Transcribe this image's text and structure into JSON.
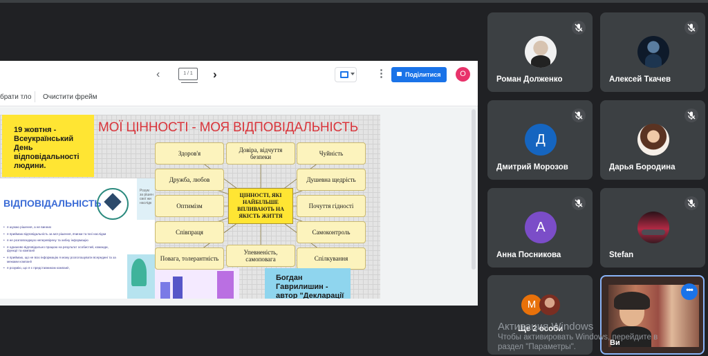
{
  "share": {
    "page_indicator": "1 / 1",
    "share_button": "Поділитися",
    "user_initial": "O",
    "toolbar2": {
      "item1": "брати тло",
      "item2": "Очистити фрейм"
    }
  },
  "slide": {
    "date_box": {
      "line1": "19 жовтня -",
      "line2": "Всеукраїнський",
      "line3": "День",
      "line4": "відповідальності",
      "line5": "людини."
    },
    "title": "МОЇ ЦІННОСТІ - МОЯ ВІДПОВІДАЛЬНІСТЬ",
    "resp_title": "ВІДПОВІДАЛЬНІСТЬ",
    "resp_side": {
      "l1": "Розум",
      "l2": "за рішен",
      "l3": "свої жи",
      "l4": "наслідк"
    },
    "resp_items": [
      "я шукаю рішення, а не винних",
      "я приймаю відповідальність за мої рішення, вчинки та їхні наслідки",
      "я не розповсюджую неперевірену та хибну інформацію",
      "я однаково відповідально працюю на результат особистий, команди, функції та компанії",
      "я приймаю, що не всю інформацію я можу розголошувати всередині та за межами компанії",
      "я розумію, що я є представником компанії,"
    ],
    "values": {
      "health": "Здоров'я",
      "trust": "Довіра, відчуття безпеки",
      "sensitivity": "Чуйність",
      "friendship": "Дружба, любов",
      "generosity": "Душевна щедрість",
      "optimism": "Оптимізм",
      "center": "ЦІННОСТІ, ЯКІ НАЙБІЛЬШЕ ВПЛИВАЮТЬ НА ЯКІСТЬ ЖИТТЯ",
      "dignity": "Почуття гідності",
      "cooperation": "Співпраця",
      "selfcontrol": "Самоконтроль",
      "respect": "Повага, толерантність",
      "confidence": "Упевненість, самоповага",
      "communication": "Спілкування"
    },
    "quote_box": {
      "line1": "Богдан",
      "line2": "Гаврилишин -",
      "line3": "автор \"Декларації"
    }
  },
  "participants": [
    {
      "name": "Роман Долженко"
    },
    {
      "name": "Алексей Ткачев"
    },
    {
      "name": "Дмитрий Морозов",
      "initial": "Д",
      "color": "#1565c0"
    },
    {
      "name": "Дарья Бородина"
    },
    {
      "name": "Анна Посникова",
      "initial": "А",
      "color": "#7b4dc8"
    },
    {
      "name": "Stefan"
    }
  ],
  "more": {
    "label": "Ще 2 особи",
    "initial": "М",
    "color": "#e8710a"
  },
  "self": {
    "label": "Ви"
  },
  "watermark": {
    "line1": "Активация Windows",
    "line2": "Чтобы активировать Windows, перейдите в",
    "line3": "раздел \"Параметры\"."
  }
}
